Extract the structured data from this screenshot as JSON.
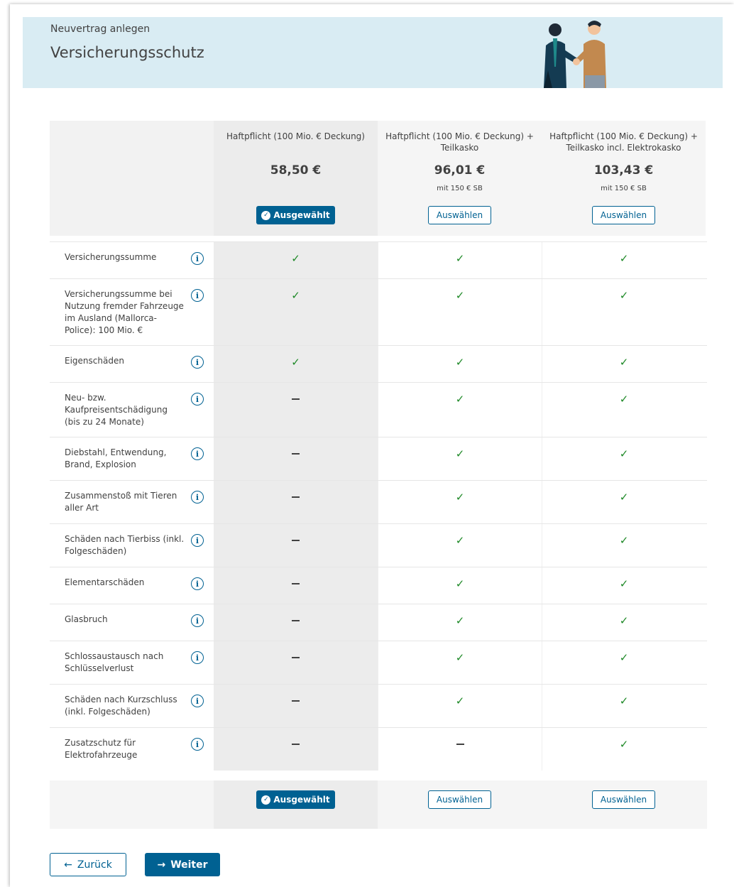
{
  "banner": {
    "subtitle": "Neuvertrag anlegen",
    "title": "Versicherungsschutz"
  },
  "plans": [
    {
      "name": "Haftpflicht (100 Mio. € Deckung)",
      "price": "58,50 €",
      "note": "",
      "button": "Ausgewählt",
      "selected": true
    },
    {
      "name": "Haftpflicht (100 Mio. € Deckung) + Teilkasko",
      "price": "96,01 €",
      "note": "mit 150 € SB",
      "button": "Auswählen",
      "selected": false
    },
    {
      "name": "Haftpflicht (100 Mio. € Deckung) + Teilkasko incl. Elektrokasko",
      "price": "103,43 €",
      "note": "mit 150 € SB",
      "button": "Auswählen",
      "selected": false
    }
  ],
  "features": [
    {
      "label": "Versicherungssumme",
      "marks": [
        "check",
        "check",
        "check"
      ]
    },
    {
      "label": "Versicherungssumme bei Nutzung fremder Fahrzeuge im Ausland (Mallorca-Police): 100 Mio. €",
      "marks": [
        "check",
        "check",
        "check"
      ]
    },
    {
      "label": "Eigenschäden",
      "marks": [
        "check",
        "check",
        "check"
      ]
    },
    {
      "label": "Neu- bzw. Kaufpreisentschädigung (bis zu 24 Monate)",
      "marks": [
        "dash",
        "check",
        "check"
      ]
    },
    {
      "label": "Diebstahl, Entwendung, Brand, Explosion",
      "marks": [
        "dash",
        "check",
        "check"
      ]
    },
    {
      "label": "Zusammenstoß mit Tieren aller Art",
      "marks": [
        "dash",
        "check",
        "check"
      ]
    },
    {
      "label": "Schäden nach Tierbiss (inkl. Folgeschäden)",
      "marks": [
        "dash",
        "check",
        "check"
      ]
    },
    {
      "label": "Elementarschäden",
      "marks": [
        "dash",
        "check",
        "check"
      ]
    },
    {
      "label": "Glasbruch",
      "marks": [
        "dash",
        "check",
        "check"
      ]
    },
    {
      "label": "Schlossaustausch nach Schlüsselverlust",
      "marks": [
        "dash",
        "check",
        "check"
      ]
    },
    {
      "label": "Schäden nach Kurzschluss (inkl. Folgeschäden)",
      "marks": [
        "dash",
        "check",
        "check"
      ]
    },
    {
      "label": "Zusatzschutz für Elektrofahrzeuge",
      "marks": [
        "dash",
        "dash",
        "check"
      ]
    }
  ],
  "icons": {
    "info": "info-icon",
    "check": "check-icon",
    "dash": "dash-icon",
    "selected": "check-circle-icon"
  },
  "nav": {
    "back_label": "Zurück",
    "next_label": "Weiter"
  },
  "colors": {
    "primary": "#006192",
    "banner_bg": "#d9ecf3",
    "check": "#1e8927",
    "selected_col": "#ececec"
  }
}
